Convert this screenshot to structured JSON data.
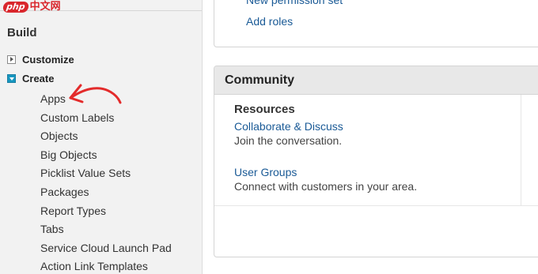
{
  "watermark": {
    "logo": "php",
    "text": "中文网"
  },
  "sidebar": {
    "heading": "Build",
    "nodes": [
      {
        "label": "Customize",
        "state": "collapsed"
      },
      {
        "label": "Create",
        "state": "expanded"
      }
    ],
    "create_children": [
      "Apps",
      "Custom Labels",
      "Objects",
      "Big Objects",
      "Picklist Value Sets",
      "Packages",
      "Report Types",
      "Tabs",
      "Service Cloud Launch Pad",
      "Action Link Templates"
    ],
    "annotation": {
      "points_to": "Apps",
      "color": "#e32b2b"
    }
  },
  "main": {
    "top_links": [
      "New permission set",
      "Add roles"
    ],
    "community": {
      "title": "Community",
      "resources_heading": "Resources",
      "resources": [
        {
          "link": "Collaborate & Discuss",
          "description": "Join the conversation."
        },
        {
          "link": "User Groups",
          "description": "Connect with customers in your area."
        }
      ]
    }
  },
  "colors": {
    "link": "#1a5a96",
    "expanded_toggle": "#1797c0",
    "header_bg": "#e8e8e8",
    "sidebar_bg": "#f2f2f2"
  }
}
